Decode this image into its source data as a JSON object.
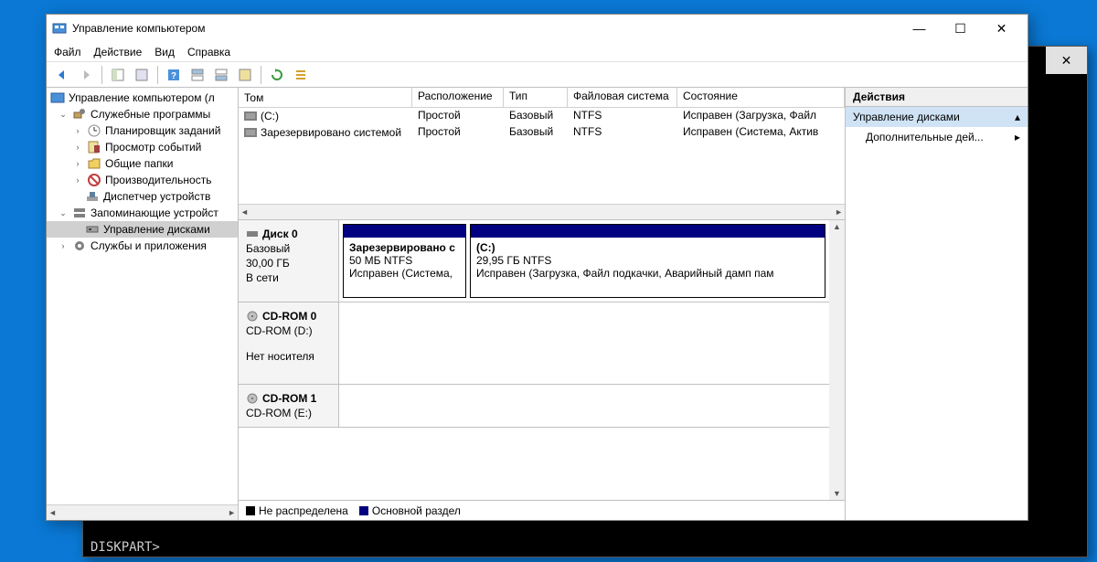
{
  "cmd": {
    "prompt": "DISKPART>"
  },
  "window": {
    "title": "Управление компьютером"
  },
  "menu": {
    "file": "Файл",
    "action": "Действие",
    "view": "Вид",
    "help": "Справка"
  },
  "tree": {
    "root": "Управление компьютером (л",
    "tools": "Служебные программы",
    "scheduler": "Планировщик заданий",
    "events": "Просмотр событий",
    "shared": "Общие папки",
    "perf": "Производительность",
    "devmgr": "Диспетчер устройств",
    "storage": "Запоминающие устройст",
    "diskmgmt": "Управление дисками",
    "services": "Службы и приложения"
  },
  "vl": {
    "headers": {
      "volume": "Том",
      "layout": "Расположение",
      "type": "Тип",
      "fs": "Файловая система",
      "status": "Состояние"
    },
    "rows": [
      {
        "vol": "(C:)",
        "layout": "Простой",
        "type": "Базовый",
        "fs": "NTFS",
        "status": "Исправен (Загрузка, Файл"
      },
      {
        "vol": "Зарезервировано системой",
        "layout": "Простой",
        "type": "Базовый",
        "fs": "NTFS",
        "status": "Исправен (Система, Актив"
      }
    ]
  },
  "disks": {
    "d0": {
      "title": "Диск 0",
      "type": "Базовый",
      "size": "30,00 ГБ",
      "status": "В сети",
      "p1": {
        "name": "Зарезервировано с",
        "size": "50 МБ NTFS",
        "status": "Исправен (Система,"
      },
      "p2": {
        "name": "(C:)",
        "size": "29,95 ГБ NTFS",
        "status": "Исправен (Загрузка, Файл подкачки, Аварийный дамп пам"
      }
    },
    "d1": {
      "title": "CD-ROM 0",
      "drive": "CD-ROM (D:)",
      "status": "Нет носителя"
    },
    "d2": {
      "title": "CD-ROM 1",
      "drive": "CD-ROM (E:)"
    }
  },
  "legend": {
    "unalloc": "Не распределена",
    "primary": "Основной раздел"
  },
  "actions": {
    "header": "Действия",
    "section": "Управление дисками",
    "more": "Дополнительные дей..."
  }
}
